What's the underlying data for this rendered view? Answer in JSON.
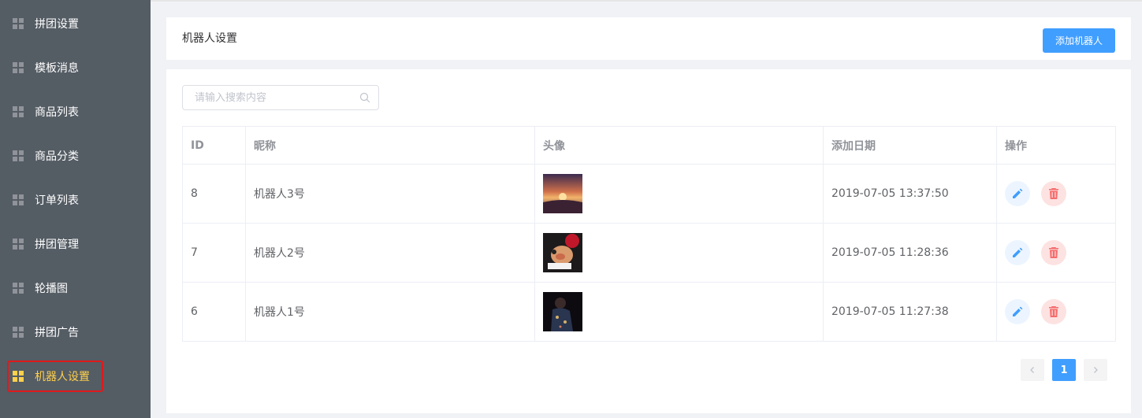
{
  "sidebar": {
    "items": [
      {
        "label": "拼团设置"
      },
      {
        "label": "模板消息"
      },
      {
        "label": "商品列表"
      },
      {
        "label": "商品分类"
      },
      {
        "label": "订单列表"
      },
      {
        "label": "拼团管理"
      },
      {
        "label": "轮播图"
      },
      {
        "label": "拼团广告"
      },
      {
        "label": "机器人设置",
        "active": true
      }
    ],
    "active_color": "#ffd04b",
    "bg_color": "#545c64"
  },
  "header": {
    "title": "机器人设置",
    "add_button_label": "添加机器人"
  },
  "search": {
    "placeholder": "请输入搜索内容"
  },
  "table": {
    "columns": [
      "ID",
      "昵称",
      "头像",
      "添加日期",
      "操作"
    ],
    "rows": [
      {
        "id": "8",
        "nickname": "机器人3号",
        "avatar": "sunset-photo",
        "date": "2019-07-05 13:37:50"
      },
      {
        "id": "7",
        "nickname": "机器人2号",
        "avatar": "mario-photo",
        "date": "2019-07-05 11:28:36"
      },
      {
        "id": "6",
        "nickname": "机器人1号",
        "avatar": "portrait-photo",
        "date": "2019-07-05 11:27:38"
      }
    ]
  },
  "pagination": {
    "current_page": "1",
    "prev_icon": "chevron-left-icon",
    "next_icon": "chevron-right-icon"
  },
  "colors": {
    "primary": "#409eff",
    "danger": "#f56c6c"
  }
}
